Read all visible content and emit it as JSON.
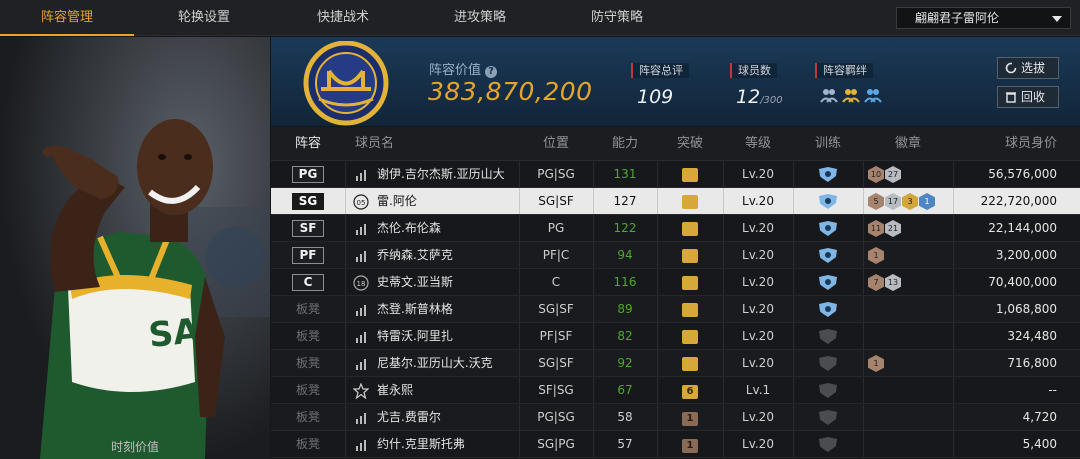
{
  "nav": {
    "tabs": [
      "阵容管理",
      "轮换设置",
      "快捷战术",
      "进攻策略",
      "防守策略"
    ],
    "active_tab": 0,
    "user_dropdown": "翩翩君子雷阿伦"
  },
  "photo": {
    "caption": "时刻价值"
  },
  "summary": {
    "value_label": "阵容价值",
    "value": "383,870,200",
    "overall_label": "阵容总评",
    "overall": "109",
    "count_label": "球员数",
    "count": "12",
    "count_max": "/300",
    "bond_label": "阵容羁绊",
    "btn_pick": "选拔",
    "btn_recycle": "回收"
  },
  "table": {
    "headers": [
      "阵容",
      "球员名",
      "位置",
      "能力",
      "突破",
      "等级",
      "训练",
      "徽章",
      "球员身价"
    ],
    "rows": [
      {
        "slot": "PG",
        "starter": true,
        "name": "谢伊.吉尔杰斯.亚历山大",
        "pos": "PG|SG",
        "ability": "131",
        "green": true,
        "brk": "",
        "brk_type": "gold",
        "level": "Lv.20",
        "train": true,
        "badges": [
          [
            "10",
            "b-bronze"
          ],
          [
            "27",
            "b-silver"
          ]
        ],
        "salary": "56,576,000"
      },
      {
        "slot": "SG",
        "starter": true,
        "selected": true,
        "num": "05",
        "name": "雷.阿伦",
        "pos": "SG|SF",
        "ability": "127",
        "green": false,
        "brk": "",
        "brk_type": "gold",
        "level": "Lv.20",
        "train": true,
        "badges": [
          [
            "5",
            "b-bronze"
          ],
          [
            "17",
            "b-silver"
          ],
          [
            "3",
            "b-gold"
          ],
          [
            "1",
            "b-blue"
          ]
        ],
        "salary": "222,720,000"
      },
      {
        "slot": "SF",
        "starter": true,
        "name": "杰伦.布伦森",
        "pos": "PG",
        "ability": "122",
        "green": true,
        "brk": "",
        "brk_type": "gold",
        "level": "Lv.20",
        "train": true,
        "badges": [
          [
            "11",
            "b-bronze"
          ],
          [
            "21",
            "b-silver"
          ]
        ],
        "salary": "22,144,000"
      },
      {
        "slot": "PF",
        "starter": true,
        "name": "乔纳森.艾萨克",
        "pos": "PF|C",
        "ability": "94",
        "green": true,
        "brk": "",
        "brk_type": "gold",
        "level": "Lv.20",
        "train": true,
        "badges": [
          [
            "1",
            "b-bronze"
          ]
        ],
        "salary": "3,200,000"
      },
      {
        "slot": "C",
        "starter": true,
        "num": "18",
        "name": "史蒂文.亚当斯",
        "pos": "C",
        "ability": "116",
        "green": true,
        "brk": "",
        "brk_type": "gold",
        "level": "Lv.20",
        "train": true,
        "badges": [
          [
            "7",
            "b-bronze"
          ],
          [
            "13",
            "b-silver"
          ]
        ],
        "salary": "70,400,000"
      },
      {
        "slot": "板凳",
        "starter": false,
        "name": "杰登.斯普林格",
        "pos": "SG|SF",
        "ability": "89",
        "green": true,
        "brk": "",
        "brk_type": "gold",
        "level": "Lv.20",
        "train": true,
        "badges": [],
        "salary": "1,068,800"
      },
      {
        "slot": "板凳",
        "starter": false,
        "name": "特雷沃.阿里扎",
        "pos": "PF|SF",
        "ability": "82",
        "green": true,
        "brk": "",
        "brk_type": "gold",
        "level": "Lv.20",
        "train": false,
        "badges": [],
        "salary": "324,480"
      },
      {
        "slot": "板凳",
        "starter": false,
        "name": "尼基尔.亚历山大.沃克",
        "pos": "SG|SF",
        "ability": "92",
        "green": true,
        "brk": "",
        "brk_type": "gold",
        "level": "Lv.20",
        "train": false,
        "badges": [
          [
            "1",
            "b-bronze"
          ]
        ],
        "salary": "716,800"
      },
      {
        "slot": "板凳",
        "starter": false,
        "star": true,
        "name": "崔永熙",
        "pos": "SF|SG",
        "ability": "67",
        "green": true,
        "brk": "6",
        "brk_type": "gold",
        "level": "Lv.1",
        "train": false,
        "badges": [],
        "salary": "--"
      },
      {
        "slot": "板凳",
        "starter": false,
        "name": "尤吉.费雷尔",
        "pos": "PG|SG",
        "ability": "58",
        "green": false,
        "brk": "1",
        "brk_type": "brown",
        "level": "Lv.20",
        "train": false,
        "badges": [],
        "salary": "4,720"
      },
      {
        "slot": "板凳",
        "starter": false,
        "name": "约什.克里斯托弗",
        "pos": "SG|PG",
        "ability": "57",
        "green": false,
        "brk": "1",
        "brk_type": "brown",
        "level": "Lv.20",
        "train": false,
        "badges": [],
        "salary": "5,400"
      }
    ]
  }
}
